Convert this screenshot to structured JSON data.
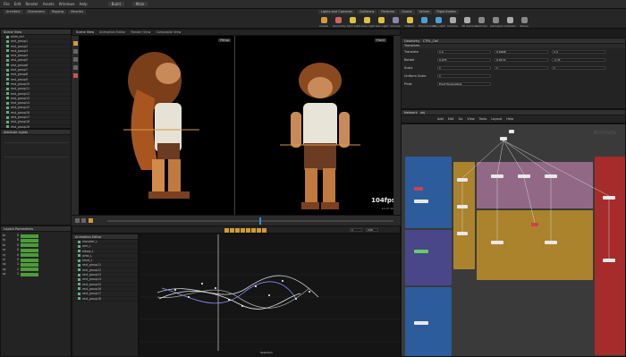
{
  "menubar": {
    "items": [
      "File",
      "Edit",
      "Render",
      "Assets",
      "Windows",
      "Help"
    ],
    "build_label": "Build",
    "search_hint": "Main"
  },
  "shelf": {
    "left_tabs": [
      "Architect",
      "Characters",
      "Rigging",
      "Muscles"
    ],
    "right_tabs": [
      "Lights and Cameras",
      "Collisions",
      "Particles",
      "Grains",
      "Vellum",
      "Rigid Bodies",
      "Particle Fluids",
      "Viscous Fluids"
    ],
    "tools": [
      {
        "label": "Create",
        "color": "#d59a3a"
      },
      {
        "label": "Geometry",
        "color": "#c66"
      },
      {
        "label": "Spot Light",
        "color": "#e0c040"
      },
      {
        "label": "Area Light",
        "color": "#e0c040"
      },
      {
        "label": "Geo Light",
        "color": "#e0c040"
      },
      {
        "label": "Volume",
        "color": "#88a"
      },
      {
        "label": "Distant",
        "color": "#e0c040"
      },
      {
        "label": "Environment",
        "color": "#4aa0d0"
      },
      {
        "label": "Sky Light",
        "color": "#4aa0d0"
      },
      {
        "label": "Camera",
        "color": "#aaa"
      },
      {
        "label": "VR Camera",
        "color": "#aaa"
      },
      {
        "label": "Switcher",
        "color": "#888"
      },
      {
        "label": "Gamepad",
        "color": "#888"
      },
      {
        "label": "Ambient",
        "color": "#aaa"
      },
      {
        "label": "Stereo",
        "color": "#888"
      }
    ]
  },
  "left": {
    "tree_header": "Scene View",
    "tree_items": [
      "anim_ctrl",
      "rest_group1",
      "rest_group2",
      "rest_group3",
      "rest_group4",
      "rest_group5",
      "rest_group6",
      "rest_group7",
      "rest_group8",
      "rest_group9",
      "rest_group10",
      "rest_group11",
      "rest_group12",
      "rest_group13",
      "rest_group14",
      "rest_group15",
      "rest_group16",
      "rest_group17",
      "rest_group18",
      "rest_group19",
      "rest_group20",
      "rest_group21",
      "rest_group22",
      "rest_group23"
    ],
    "mid_header": "Attribute Lights",
    "bottom_header": "Layout Parameters",
    "channels": [
      {
        "label": "tx",
        "value": "0"
      },
      {
        "label": "ty",
        "value": "0"
      },
      {
        "label": "tz",
        "value": "0"
      },
      {
        "label": "rx",
        "value": "0"
      },
      {
        "label": "ry",
        "value": "0"
      },
      {
        "label": "rz",
        "value": "0"
      },
      {
        "label": "sx",
        "value": "1"
      },
      {
        "label": "sy",
        "value": "1"
      },
      {
        "label": "sz",
        "value": "1"
      }
    ]
  },
  "viewport": {
    "tabs": [
      "Scene View",
      "Animation Editor",
      "Render View",
      "Composite View"
    ],
    "left_view_label": "Persp",
    "right_view_label": "Front",
    "fps": "104fps",
    "fps_sub": "0.0 of 120"
  },
  "timeline": {
    "frame": "1",
    "end_frame": "240"
  },
  "anim_editor": {
    "header": "Animation Editor",
    "channels": [
      "shoulder_L",
      "arm_L",
      "elbow_L",
      "wrist_L",
      "hand_L",
      "rest_group11",
      "rest_group12",
      "rest_group13",
      "rest_group14",
      "rest_group15",
      "rest_group16",
      "rest_group17",
      "rest_group18"
    ],
    "footer": "Selection"
  },
  "params": {
    "header": "Geometry",
    "node_name": "CTRL_Cell",
    "tab": "Transform",
    "rows": [
      {
        "label": "Translate",
        "v": [
          "1.2",
          "0.0008",
          "1.4"
        ]
      },
      {
        "label": "Rotate",
        "v": [
          "0.075",
          "0.0174",
          "-1.71"
        ]
      },
      {
        "label": "Scale",
        "v": [
          "1",
          "1",
          "1"
        ]
      },
      {
        "label": "Uniform Scale",
        "v": [
          "1"
        ]
      },
      {
        "label": "Pivot",
        "v": [
          "Pivot Parameters"
        ]
      }
    ]
  },
  "network": {
    "header": "Network",
    "path": "obj",
    "menu": [
      "Add",
      "Edit",
      "Go",
      "View",
      "Tools",
      "Layout",
      "Help"
    ],
    "watermark": "Animate"
  }
}
